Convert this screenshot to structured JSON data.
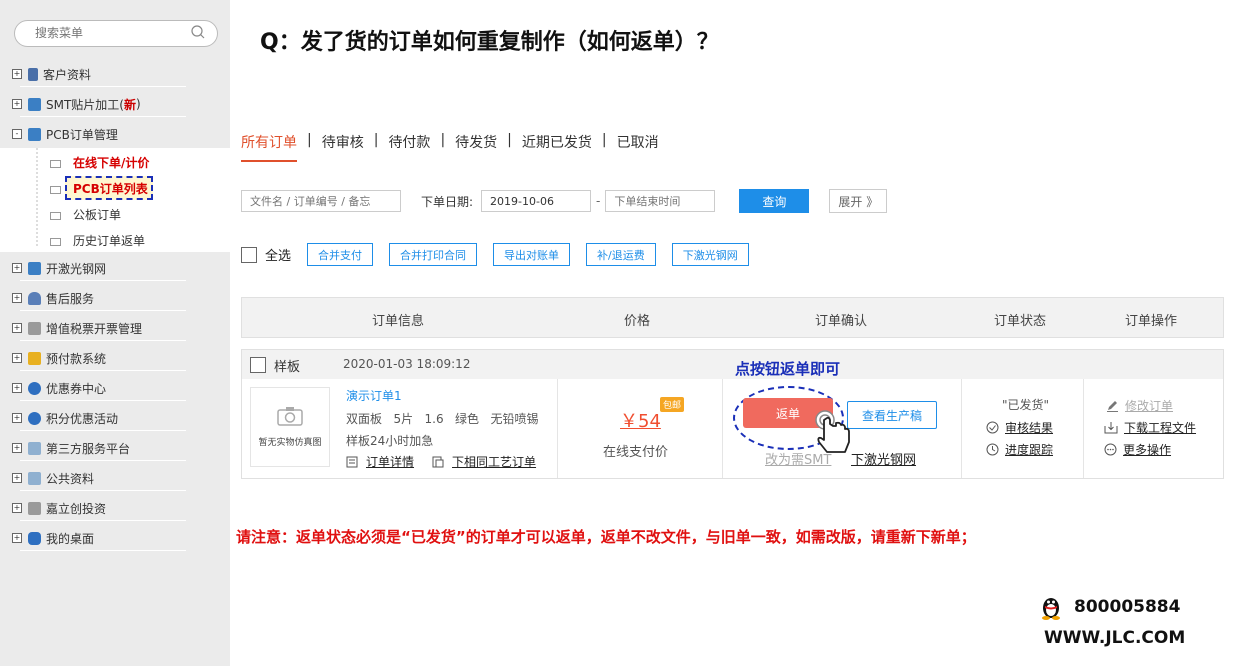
{
  "search": {
    "placeholder": "搜索菜单"
  },
  "sidebar": {
    "items": [
      {
        "label": "客户资料",
        "icon": "customer-icon",
        "expand": "+"
      },
      {
        "label": "SMT贴片加工(",
        "badge": "新",
        "tail": ")",
        "icon": "smt-icon",
        "expand": "+"
      },
      {
        "label": "PCB订单管理",
        "icon": "pcb-icon",
        "expand": "-"
      },
      {
        "label": "开激光钢网",
        "icon": "laser-icon",
        "expand": "+"
      },
      {
        "label": "售后服务",
        "icon": "service-icon",
        "expand": "+"
      },
      {
        "label": "增值税票开票管理",
        "icon": "invoice-icon",
        "expand": "+"
      },
      {
        "label": "预付款系统",
        "icon": "prepay-icon",
        "expand": "+"
      },
      {
        "label": "优惠券中心",
        "icon": "coupon-icon",
        "expand": "+"
      },
      {
        "label": "积分优惠活动",
        "icon": "points-icon",
        "expand": "+"
      },
      {
        "label": "第三方服务平台",
        "icon": "third-party-icon",
        "expand": "+"
      },
      {
        "label": "公共资料",
        "icon": "public-icon",
        "expand": "+"
      },
      {
        "label": "嘉立创投资",
        "icon": "invest-icon",
        "expand": "+"
      },
      {
        "label": "我的桌面",
        "icon": "desktop-icon",
        "expand": "+"
      }
    ],
    "subitems": [
      {
        "label": "在线下单/计价"
      },
      {
        "label": "PCB订单列表"
      },
      {
        "label": "公板订单"
      },
      {
        "label": "历史订单返单"
      }
    ]
  },
  "page": {
    "title": "Q：发了货的订单如何重复制作（如何返单）？"
  },
  "tabs": [
    "所有订单",
    "待审核",
    "待付款",
    "待发货",
    "近期已发货",
    "已取消"
  ],
  "tab_separator": "|",
  "filter": {
    "keyword_placeholder": "文件名 / 订单编号 / 备忘",
    "date_label": "下单日期:",
    "date_start": "2019-10-06",
    "date_dash": "-",
    "date_end_placeholder": "下单结束时间",
    "query_label": "查询",
    "expand_label": "展开 》"
  },
  "actions": {
    "select_all": "全选",
    "buttons": [
      "合并支付",
      "合并打印合同",
      "导出对账单",
      "补/退运费",
      "下激光钢网"
    ]
  },
  "table": {
    "headers": [
      "订单信息",
      "价格",
      "订单确认",
      "订单状态",
      "订单操作"
    ]
  },
  "order": {
    "type": "样板",
    "datetime": "2020-01-03 18:09:12",
    "thumb_label": "暂无实物仿真图",
    "name": "演示订单1",
    "spec": "双面板   5片   1.6   绿色   无铅喷锡",
    "speed": "样板24小时加急",
    "detail_link": "订单详情",
    "same_link": "下相同工艺订单",
    "price": "￥54",
    "free_ship": "包邮",
    "pay_type": "在线支付价",
    "reorder_label": "返单",
    "view_prod_label": "查看生产稿",
    "smt_link": "改为需SMT",
    "laser_link": "下激光钢网",
    "status": "\"已发货\"",
    "review_link": "审核结果",
    "progress_link": "进度跟踪",
    "modify_link": "修改订单",
    "download_link": "下载工程文件",
    "more_link": "更多操作"
  },
  "annotations": {
    "click_hint": "点按钮返单即可",
    "notice": "请注意：返单状态必须是“已发货”的订单才可以返单，返单不改文件，与旧单一致，如需改版，请重新下新单；"
  },
  "contact": {
    "qq": "800005884",
    "website": "WWW.JLC.COM"
  },
  "colors": {
    "accent_orange": "#e0502c",
    "primary_blue": "#1e8ee8",
    "annotation_blue": "#1a2fb8",
    "notice_red": "#e01010"
  }
}
